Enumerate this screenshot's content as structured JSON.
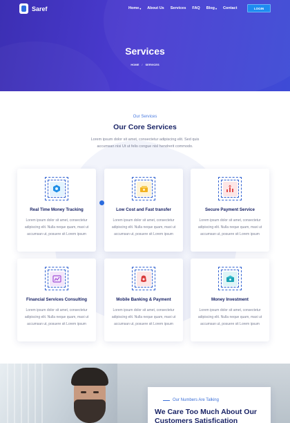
{
  "header": {
    "logo_text": "Saref",
    "nav": [
      {
        "label": "Home",
        "dropdown": true
      },
      {
        "label": "About Us",
        "dropdown": false
      },
      {
        "label": "Services",
        "dropdown": false
      },
      {
        "label": "FAQ",
        "dropdown": false
      },
      {
        "label": "Blog",
        "dropdown": true
      },
      {
        "label": "Contact",
        "dropdown": false
      }
    ],
    "login_label": "LOGIN"
  },
  "hero": {
    "title": "Services",
    "breadcrumb": [
      "HOME",
      "SERVICES"
    ],
    "breadcrumb_sep": "/"
  },
  "services": {
    "subtitle": "Our Services",
    "title": "Our Core Services",
    "description": "Lorem ipsum dolor sit amet, consectetur adipiscing elit. Sed quis accumsan nisi Ut ut felis congue nisl hendrerit commodo.",
    "cards": [
      {
        "title": "Real Time Money Tracking",
        "text": "Lorem ipsum dolor sit amet, consectetur adipiscing elit. Nulla neque quam, maxi ut accumsan ut, posuere sit Lorem ipsum",
        "icon": "tracking-icon",
        "icon_bg": "#e3f4ff",
        "icon_color": "#1f8fe6"
      },
      {
        "title": "Low Cost and Fast transfer",
        "text": "Lorem ipsum dolor sit amet, consectetur adipiscing elit. Nulla neque quam, maxi ut accumsan ut, posuere sit Lorem ipsum",
        "icon": "money-transfer-icon",
        "icon_bg": "#fff4d6",
        "icon_color": "#f2b21e"
      },
      {
        "title": "Secure Payment Service",
        "text": "Lorem ipsum dolor sit amet, consectetur adipiscing elit. Nulla neque quam, maxi ut accumsan ut, posuere sit Lorem ipsum",
        "icon": "secure-payment-icon",
        "icon_bg": "#fde6e6",
        "icon_color": "#e0484a"
      },
      {
        "title": "Financial Services Consulting",
        "text": "Lorem ipsum dolor sit amet, consectetur adipiscing elit. Nulla neque quam, maxi ut accumsan ut, posuere sit Lorem ipsum",
        "icon": "consulting-icon",
        "icon_bg": "#f3e6fb",
        "icon_color": "#a24fd6"
      },
      {
        "title": "Mobile Banking & Payment",
        "text": "Lorem ipsum dolor sit amet, consectetur adipiscing elit. Nulla neque quam, maxi ut accumsan ut, posuere sit Lorem ipsum",
        "icon": "mobile-banking-icon",
        "icon_bg": "#fde6e6",
        "icon_color": "#d93a3a"
      },
      {
        "title": "Money Investment",
        "text": "Lorem ipsum dolor sit amet, consectetur adipiscing elit. Nulla neque quam, maxi ut accumsan ut, posuere sit Lorem ipsum",
        "icon": "investment-icon",
        "icon_bg": "#dff5f7",
        "icon_color": "#1aa3b5"
      }
    ]
  },
  "numbers": {
    "subtitle": "Our Numbers Are Talking",
    "title": "We Care Too Much About Our Customers Satisfication"
  },
  "colors": {
    "hero_start": "#3c2fb3",
    "hero_end": "#3e4bd6",
    "accent": "#2d6fe2",
    "heading": "#1a2466"
  }
}
